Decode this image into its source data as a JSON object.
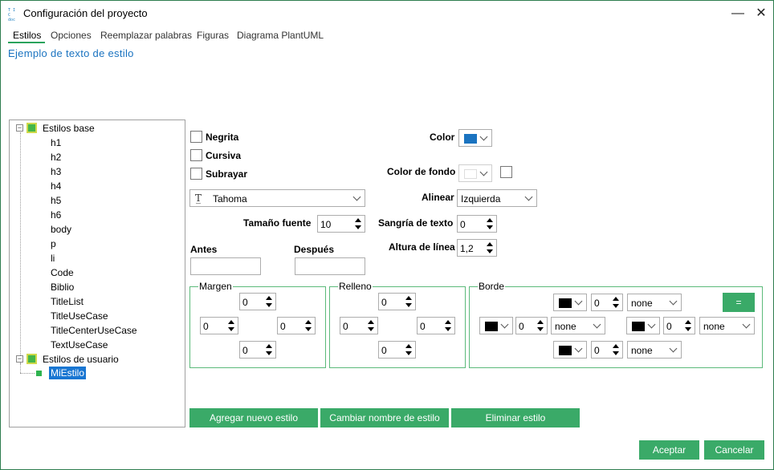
{
  "window": {
    "title": "Configuración del proyecto",
    "icon_text": "TIC\ndoc",
    "minimize": "—",
    "close": "✕"
  },
  "tabs": [
    "Estilos",
    "Opciones",
    "Reemplazar palabras",
    "Figuras",
    "Diagrama PlantUML"
  ],
  "sample_text": "Ejemplo de texto de estilo",
  "tree": {
    "base_label": "Estilos base",
    "base_items": [
      "h1",
      "h2",
      "h3",
      "h4",
      "h5",
      "h6",
      "body",
      "p",
      "li",
      "Code",
      "Biblio",
      "TitleList",
      "TitleUseCase",
      "TitleCenterUseCase",
      "TextUseCase"
    ],
    "user_label": "Estilos de usuario",
    "user_items": [
      "MiEstilo"
    ]
  },
  "format": {
    "bold": "Negrita",
    "italic": "Cursiva",
    "underline": "Subrayar",
    "font": "Tahoma",
    "font_size_label": "Tamaño fuente",
    "font_size": "10",
    "before_label": "Antes",
    "after_label": "Después",
    "before_value": "",
    "after_value": "",
    "color_label": "Color",
    "color": "#1a73c0",
    "bg_label": "Color de fondo",
    "bg_color": "#ffffff",
    "align_label": "Alinear",
    "align": "Izquierda",
    "indent_label": "Sangría de texto",
    "indent": "0",
    "line_height_label": "Altura de línea",
    "line_height": "1,2"
  },
  "margin": {
    "label": "Margen",
    "top": "0",
    "left": "0",
    "right": "0",
    "bottom": "0"
  },
  "padding": {
    "label": "Relleno",
    "top": "0",
    "left": "0",
    "right": "0",
    "bottom": "0"
  },
  "border": {
    "label": "Borde",
    "equal": "=",
    "top": {
      "width": "0",
      "style": "none",
      "color": "#000000"
    },
    "left": {
      "width": "0",
      "style": "none",
      "color": "#000000"
    },
    "right": {
      "width": "0",
      "style": "none",
      "color": "#000000"
    },
    "bottom": {
      "width": "0",
      "style": "none",
      "color": "#000000"
    }
  },
  "buttons": {
    "add": "Agregar nuevo estilo",
    "rename": "Cambiar nombre de estilo",
    "delete": "Eliminar estilo",
    "ok": "Aceptar",
    "cancel": "Cancelar"
  },
  "accent": "#3aaa68"
}
